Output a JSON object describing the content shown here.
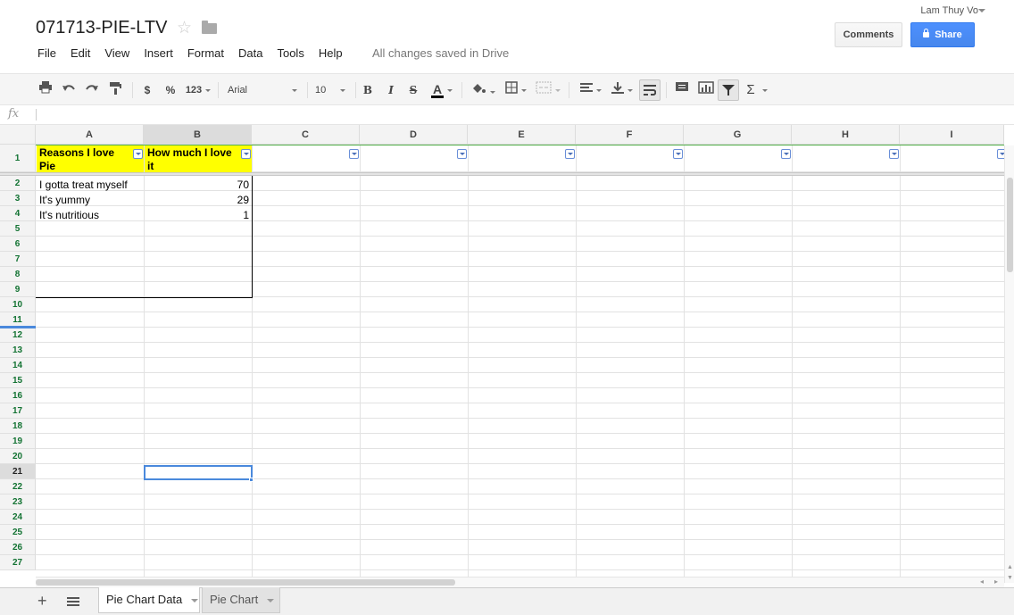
{
  "header": {
    "doc_title": "071713-PIE-LTV",
    "save_status": "All changes saved in Drive",
    "user_name": "Lam Thuy Vo",
    "comments_label": "Comments",
    "share_label": "Share",
    "menu": [
      "File",
      "Edit",
      "View",
      "Insert",
      "Format",
      "Data",
      "Tools",
      "Help"
    ]
  },
  "toolbar": {
    "currency_label": "$",
    "percent_label": "%",
    "number_format_label": "123",
    "font_family": "Arial",
    "font_size": "10",
    "bold_label": "B",
    "italic_label": "I",
    "strike_label": "S",
    "text_color_label": "A",
    "sum_label": "Σ",
    "text_color": "#000000"
  },
  "formula_bar": {
    "fx_label": "fx",
    "value": ""
  },
  "grid": {
    "columns": [
      "A",
      "B",
      "C",
      "D",
      "E",
      "F",
      "G",
      "H",
      "I"
    ],
    "selected_column": "B",
    "selected_row": "21",
    "rows": [
      "1",
      "2",
      "3",
      "4",
      "5",
      "6",
      "7",
      "8",
      "9",
      "10",
      "11",
      "12",
      "13",
      "14",
      "15",
      "16",
      "17",
      "18",
      "19",
      "20",
      "21",
      "22",
      "23",
      "24",
      "25",
      "26",
      "27"
    ],
    "header_row": {
      "a1": "Reasons I love Pie",
      "b1": "How much I love it"
    },
    "data_rows": [
      {
        "label": "I gotta treat myself",
        "value": "70"
      },
      {
        "label": "It's yummy",
        "value": "29"
      },
      {
        "label": "It's nutritious",
        "value": "1"
      }
    ],
    "header_fill_color": "#ffff00",
    "selection_color": "#4a89dc"
  },
  "sheets": {
    "tabs": [
      {
        "label": "Pie Chart Data",
        "active": true
      },
      {
        "label": "Pie Chart",
        "active": false
      }
    ]
  }
}
